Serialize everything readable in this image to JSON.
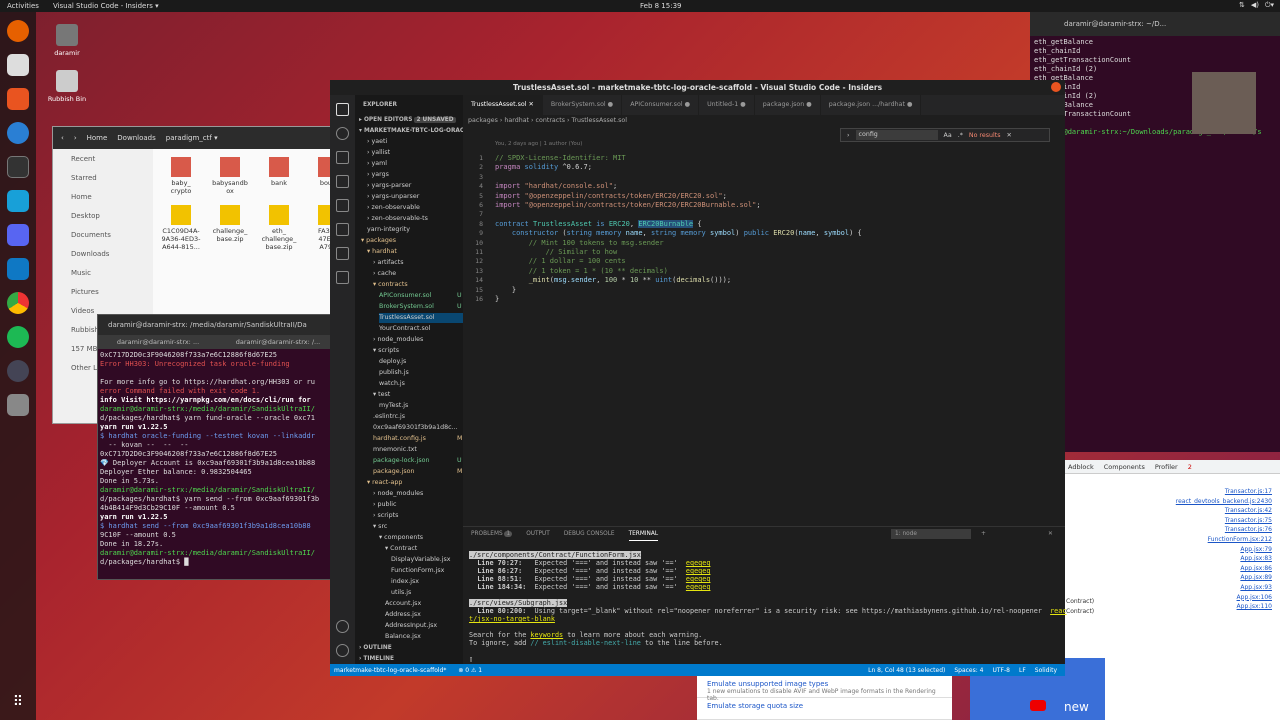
{
  "topbar": {
    "activities": "Activities",
    "app": "Visual Studio Code - Insiders ▾",
    "clock": "Feb 8  15:39"
  },
  "desktop": {
    "home": "daramir",
    "trash": "Rubbish Bin"
  },
  "files": {
    "nav": [
      "Home",
      "Downloads",
      "paradigm_ctf ▾"
    ],
    "sidebar": [
      "Recent",
      "Starred",
      "Home",
      "Desktop",
      "Documents",
      "Downloads",
      "Music",
      "Pictures",
      "Videos",
      "Rubbish",
      "157 MB",
      "Other L"
    ],
    "items": [
      "baby_\ncrypto",
      "babysandb\nox",
      "bank",
      "boun",
      "C1C09D4A-\n9A36-4ED3-\nA644-815...",
      "challenge_\nbase.zip",
      "eth_\nchallenge_\nbase.zip",
      "FA3EE\n47EC-\nA79C"
    ]
  },
  "left_terminal": {
    "title": "daramir@daramir-strx: /media/daramir/SandiskUltraII/Da",
    "tabs": [
      "daramir@daramir-strx: ...",
      "daramir@daramir-strx: /..."
    ],
    "lines": [
      "0xC717D2D0c3F9046208f733a7e6C12886f8d67E25",
      "Error HH303: Unrecognized task oracle-funding",
      "",
      "For more info go to https://hardhat.org/HH303 or ru",
      "error Command failed with exit code 1.",
      "info Visit https://yarnpkg.com/en/docs/cli/run for",
      "daramir@daramir-strx:/media/daramir/SandiskUltraII/",
      "d/packages/hardhat$ yarn fund-oracle --oracle 0xc71",
      "yarn run v1.22.5",
      "$ hardhat oracle-funding --testnet kovan --linkaddr",
      "  -- kovan --  --  --",
      "0xC717D2D0c3F9046208f733a7e6C12886f8d67E25",
      "💎 Deployer Account is 0xc9aaf69301f3b9a1d8cea10b88",
      "Deployer Ether balance: 0.9832504465",
      "Done in 5.73s.",
      "daramir@daramir-strx:/media/daramir/SandiskUltraII/",
      "d/packages/hardhat$ yarn send --from 0xc9aaf69301f3b",
      "4b4B414F9d3Cb29C10F --amount 0.5",
      "yarn run v1.22.5",
      "$ hardhat send --from 0xc9aaf69301f3b9a1d8cea10b88",
      "9C10F --amount 0.5",
      "Done in 18.27s.",
      "daramir@daramir-strx:/media/daramir/SandiskUltraII/",
      "d/packages/hardhat$ █"
    ]
  },
  "right_terminal": {
    "title": "daramir@daramir-strx: ~/D...",
    "lines": [
      "eth_getBalance",
      "eth_chainId",
      "eth_getTransactionCount",
      "eth_chainId (2)",
      "eth_getBalance",
      "eth_chainId",
      "eth_chainId (2)",
      "eth_getBalance",
      "eth_getTransactionCount",
      "",
      "daramir@daramir-strx:~/Downloads/paradigm_ctf/secure/s"
    ]
  },
  "devtools": {
    "tabs": [
      "Adblock",
      "Components",
      "Profiler"
    ],
    "badge": "2",
    "links": [
      "Transactor.js:17",
      "react_devtools_backend.js:2430",
      "Transactor.js:42",
      "Transactor.js:75",
      "Transactor.js:76",
      "FunctionForm.jsx:212",
      "App.jsx:79",
      "App.jsx:83",
      "App.jsx:86",
      "App.jsx:89",
      "App.jsx:93",
      "App.jsx:106",
      "App.jsx:110"
    ],
    "side": [
      "Contract)",
      "Contract)"
    ]
  },
  "chrome_bottom": {
    "opt1": "Emulate unsupported image types",
    "opt1_desc": "1 new emulations to disable AVIF and WebP image formats in the Rendering tab.",
    "opt2": "Emulate storage quota size",
    "video": "new"
  },
  "vscode": {
    "title": "TrustlessAsset.sol - marketmake-tbtc-log-oracle-scaffold - Visual Studio Code - Insiders",
    "explorer_header": "EXPLORER",
    "open_editors": "OPEN EDITORS",
    "unsaved": "2 UNSAVED",
    "root": "MARKETMAKE-TBTC-LOG-ORACL...",
    "tree": [
      {
        "t": "yaeti",
        "d": 1,
        "f": 1
      },
      {
        "t": "yallist",
        "d": 1,
        "f": 1
      },
      {
        "t": "yaml",
        "d": 1,
        "f": 1
      },
      {
        "t": "yargs",
        "d": 1,
        "f": 1
      },
      {
        "t": "yargs-parser",
        "d": 1,
        "f": 1
      },
      {
        "t": "yargs-unparser",
        "d": 1,
        "f": 1
      },
      {
        "t": "zen-observable",
        "d": 1,
        "f": 1
      },
      {
        "t": "zen-observable-ts",
        "d": 1,
        "f": 1
      },
      {
        "t": "yarn-integrity",
        "d": 1,
        "f": 0
      },
      {
        "t": "packages",
        "d": 0,
        "f": 1,
        "o": 1
      },
      {
        "t": "hardhat",
        "d": 1,
        "f": 1,
        "o": 1
      },
      {
        "t": "artifacts",
        "d": 2,
        "f": 1
      },
      {
        "t": "cache",
        "d": 2,
        "f": 1
      },
      {
        "t": "contracts",
        "d": 2,
        "f": 1,
        "o": 1
      },
      {
        "t": "APIConsumer.sol",
        "d": 3,
        "f": 0,
        "m": "U"
      },
      {
        "t": "BrokerSystem.sol",
        "d": 3,
        "f": 0,
        "m": "U"
      },
      {
        "t": "TrustlessAsset.sol",
        "d": 3,
        "f": 0,
        "sel": 1
      },
      {
        "t": "YourContract.sol",
        "d": 3,
        "f": 0
      },
      {
        "t": "node_modules",
        "d": 2,
        "f": 1
      },
      {
        "t": "scripts",
        "d": 2,
        "f": 1,
        "o": 1
      },
      {
        "t": "deploy.js",
        "d": 3,
        "f": 0
      },
      {
        "t": "publish.js",
        "d": 3,
        "f": 0
      },
      {
        "t": "watch.js",
        "d": 3,
        "f": 0
      },
      {
        "t": "test",
        "d": 2,
        "f": 1,
        "o": 1
      },
      {
        "t": "myTest.js",
        "d": 3,
        "f": 0
      },
      {
        "t": ".eslintrc.js",
        "d": 2,
        "f": 0
      },
      {
        "t": "0xc9aaf69301f3b9a1d8c...",
        "d": 2,
        "f": 0
      },
      {
        "t": "hardhat.config.js",
        "d": 2,
        "f": 0,
        "m": "M"
      },
      {
        "t": "mnemonic.txt",
        "d": 2,
        "f": 0
      },
      {
        "t": "package-lock.json",
        "d": 2,
        "f": 0,
        "m": "U"
      },
      {
        "t": "package.json",
        "d": 2,
        "f": 0,
        "m": "M"
      },
      {
        "t": "react-app",
        "d": 1,
        "f": 1,
        "o": 1
      },
      {
        "t": "node_modules",
        "d": 2,
        "f": 1
      },
      {
        "t": "public",
        "d": 2,
        "f": 1
      },
      {
        "t": "scripts",
        "d": 2,
        "f": 1
      },
      {
        "t": "src",
        "d": 2,
        "f": 1,
        "o": 1
      },
      {
        "t": "components",
        "d": 3,
        "f": 1,
        "o": 1
      },
      {
        "t": "Contract",
        "d": 4,
        "f": 1,
        "o": 1
      },
      {
        "t": "DisplayVariable.jsx",
        "d": 5,
        "f": 0
      },
      {
        "t": "FunctionForm.jsx",
        "d": 5,
        "f": 0
      },
      {
        "t": "index.jsx",
        "d": 5,
        "f": 0
      },
      {
        "t": "utils.js",
        "d": 5,
        "f": 0
      },
      {
        "t": "Account.jsx",
        "d": 4,
        "f": 0
      },
      {
        "t": "Address.jsx",
        "d": 4,
        "f": 0
      },
      {
        "t": "AddressInput.jsx",
        "d": 4,
        "f": 0
      },
      {
        "t": "Balance.jsx",
        "d": 4,
        "f": 0
      }
    ],
    "outline": "OUTLINE",
    "timeline": "TIMELINE",
    "tabs": [
      "TrustlessAsset.sol",
      "BrokerSystem.sol",
      "APIConsumer.sol",
      "Untitled-1",
      "package.json",
      "package.json .../hardhat"
    ],
    "breadcrumb": "packages › hardhat › contracts › TrustlessAsset.sol",
    "blame": "You, 2 days ago | 1 author (You)",
    "find_value": "config",
    "find_result": "No results",
    "panel_tabs": [
      "PROBLEMS",
      "OUTPUT",
      "DEBUG CONSOLE",
      "TERMINAL"
    ],
    "problems_count": "1",
    "term_select": "1: node",
    "status_branch": "marketmake-tbtc-log-oracle-scaffold*",
    "status_errs": "⊗ 0 ⚠ 1",
    "status_right": [
      "Ln 8, Col 48 (13 selected)",
      "Spaces: 4",
      "UTF-8",
      "LF",
      "Solidity"
    ]
  }
}
